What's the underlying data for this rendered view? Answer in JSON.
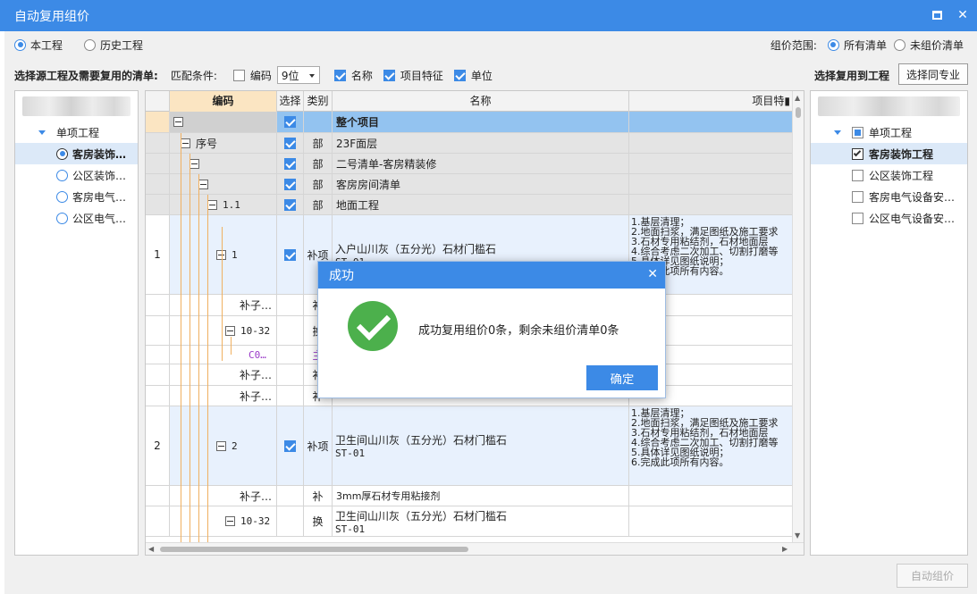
{
  "window": {
    "title": "自动复用组价",
    "max_icon": "maximize-icon",
    "close_icon": "close-icon"
  },
  "source_options": {
    "current": "本工程",
    "history": "历史工程"
  },
  "range": {
    "label": "组价范围:",
    "all": "所有清单",
    "unpriced": "未组价清单"
  },
  "filter": {
    "source_label": "选择源工程及需要复用的清单:",
    "match_label": "匹配条件:",
    "code_label": "编码",
    "code_digits": "9位",
    "name_label": "名称",
    "feature_label": "项目特征",
    "unit_label": "单位"
  },
  "target": {
    "label": "选择复用到工程",
    "same_button": "选择同专业"
  },
  "left_tree": {
    "root": "单项工程",
    "items": [
      "客房装饰…",
      "公区装饰…",
      "客房电气…",
      "公区电气…"
    ]
  },
  "right_tree": {
    "root": "单项工程",
    "items": [
      "客房装饰工程",
      "公区装饰工程",
      "客房电气设备安…",
      "公区电气设备安…"
    ]
  },
  "grid": {
    "headers": {
      "num": "",
      "code": "编码",
      "select": "选择",
      "type": "类别",
      "name": "名称",
      "feature": "项目特"
    },
    "rows": [
      {
        "num": "",
        "code": "",
        "type": "",
        "name": "整个项目",
        "feature": ""
      },
      {
        "num": "",
        "code": "序号",
        "type": "部",
        "name": "23F面层",
        "feature": ""
      },
      {
        "num": "",
        "code": "",
        "type": "部",
        "name": "二号清单-客房精装修",
        "feature": ""
      },
      {
        "num": "",
        "code": "",
        "type": "部",
        "name": "客房房间清单",
        "feature": ""
      },
      {
        "num": "",
        "code": "1.1",
        "type": "部",
        "name": "地面工程",
        "feature": ""
      },
      {
        "num": "1",
        "code": "1",
        "type": "补项",
        "name": "入户山川灰（五分光）石材门槛石",
        "name2": "ST-01",
        "feature": "1.基层清理；\n2.地面扫浆，满足图纸及施工要求\n3.石材专用粘结剂，石材地面层\n4.综合考虑二次加工、切割打磨等\n5.具体详见图纸说明；\n6.完成此项所有内容。"
      },
      {
        "num": "",
        "code": "补子…",
        "type": "补",
        "name": "",
        "feature": ""
      },
      {
        "num": "",
        "code": "10-32",
        "type": "换",
        "name": "",
        "feature": ""
      },
      {
        "num": "",
        "code": "C0…",
        "type": "主",
        "name": "",
        "feature": ""
      },
      {
        "num": "",
        "code": "补子…",
        "type": "补",
        "name": "",
        "feature": ""
      },
      {
        "num": "",
        "code": "补子…",
        "type": "补",
        "name": "",
        "feature": ""
      },
      {
        "num": "2",
        "code": "2",
        "type": "补项",
        "name": "卫生间山川灰（五分光）石材门槛石",
        "name2": "ST-01",
        "feature": "1.基层清理；\n2.地面扫浆，满足图纸及施工要求\n3.石材专用粘结剂，石材地面层\n4.综合考虑二次加工、切割打磨等\n5.具体详见图纸说明；\n6.完成此项所有内容。"
      },
      {
        "num": "",
        "code": "补子…",
        "type": "补",
        "name": "3mm厚石材专用粘接剂",
        "feature": ""
      },
      {
        "num": "",
        "code": "10-32",
        "type": "换",
        "name": "卫生间山川灰（五分光）石材门槛石",
        "name2": "ST-01",
        "feature": ""
      }
    ]
  },
  "dialog": {
    "title": "成功",
    "message": "成功复用组价0条，剩余未组价清单0条",
    "ok": "确定",
    "icon": "success-check-icon"
  },
  "footer": {
    "auto_button": "自动组价"
  },
  "colors": {
    "accent": "#3c8ae6",
    "success": "#4cb04c",
    "header_code": "#fbe5c2",
    "row_selected": "#93c3f0",
    "row_item": "#e8f1fd"
  }
}
